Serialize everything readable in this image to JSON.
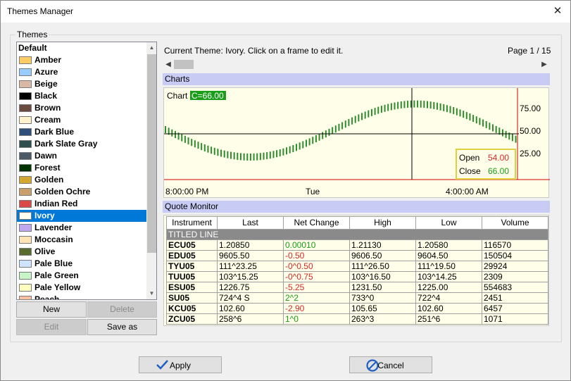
{
  "window": {
    "title": "Themes Manager",
    "close_glyph": "✕"
  },
  "themes_group": {
    "label": "Themes"
  },
  "themes": [
    {
      "name": "Default",
      "color": ""
    },
    {
      "name": "Amber",
      "color": "#ffcc66"
    },
    {
      "name": "Azure",
      "color": "#99ccff"
    },
    {
      "name": "Beige",
      "color": "#d9b8a6"
    },
    {
      "name": "Black",
      "color": "#000000"
    },
    {
      "name": "Brown",
      "color": "#6b4a3f"
    },
    {
      "name": "Cream",
      "color": "#fff2cc"
    },
    {
      "name": "Dark Blue",
      "color": "#2f4f7a"
    },
    {
      "name": "Dark Slate Gray",
      "color": "#2f4f4f"
    },
    {
      "name": "Dawn",
      "color": "#4a5a66"
    },
    {
      "name": "Forest",
      "color": "#003300"
    },
    {
      "name": "Golden",
      "color": "#d4a830"
    },
    {
      "name": "Golden Ochre",
      "color": "#c8a070"
    },
    {
      "name": "Indian Red",
      "color": "#d94a4a"
    },
    {
      "name": "Ivory",
      "color": "#fffff0",
      "selected": true
    },
    {
      "name": "Lavender",
      "color": "#c0a8f0"
    },
    {
      "name": "Moccasin",
      "color": "#ffe4b5"
    },
    {
      "name": "Olive",
      "color": "#5a6b2f"
    },
    {
      "name": "Pale Blue",
      "color": "#cfe4ff"
    },
    {
      "name": "Pale Green",
      "color": "#c8f5c8"
    },
    {
      "name": "Pale Yellow",
      "color": "#ffffc0"
    },
    {
      "name": "Peach",
      "color": "#ffc0a0"
    }
  ],
  "list_buttons": {
    "new": "New",
    "delete": "Delete",
    "edit": "Edit",
    "save_as": "Save as"
  },
  "preview": {
    "current_theme_text": "Current Theme: Ivory. Click on a frame to edit it.",
    "page": "Page 1 / 15"
  },
  "charts_section": {
    "label": "Charts"
  },
  "chart_data": {
    "type": "line",
    "title": "Chart",
    "last_value_badge": "C=66.00",
    "y_tick_labels": [
      "75.00",
      "50.00",
      "25.00"
    ],
    "ylim": [
      0,
      100
    ],
    "x_tick_labels": [
      "8:00:00 PM",
      "Tue",
      "4:00:00 AM"
    ],
    "series": [
      {
        "color": "#2e8b2e",
        "shape": "sine",
        "y_min": 20,
        "y_max": 78
      }
    ],
    "crosshair": {
      "y": 46
    },
    "data_box": {
      "open_label": "Open",
      "open_value": "54.00",
      "close_label": "Close",
      "close_value": "66.00"
    },
    "grid": false
  },
  "quote_section": {
    "label": "Quote Monitor"
  },
  "quote_columns": [
    "Instrument",
    "Last",
    "Net Change",
    "High",
    "Low",
    "Volume"
  ],
  "titled_line": "TITLED LINE",
  "quotes": [
    {
      "instrument": "ECU05",
      "last": "1.20850",
      "net": "0.00010",
      "dir": "pos",
      "high": "1.21130",
      "low": "1.20580",
      "volume": "116570"
    },
    {
      "instrument": "EDU05",
      "last": "9605.50",
      "net": "-0.50",
      "dir": "neg",
      "high": "9606.50",
      "low": "9604.50",
      "volume": "150504"
    },
    {
      "instrument": "TYU05",
      "last": "111^23.25",
      "net": "-0^0.50",
      "dir": "neg",
      "high": "111^26.50",
      "low": "111^19.50",
      "volume": "29924"
    },
    {
      "instrument": "TUU05",
      "last": "103^15.25",
      "net": "-0^0.75",
      "dir": "neg",
      "high": "103^16.50",
      "low": "103^14.25",
      "volume": "2309"
    },
    {
      "instrument": "ESU05",
      "last": "1226.75",
      "net": "-5.25",
      "dir": "neg",
      "high": "1231.50",
      "low": "1225.00",
      "volume": "554683"
    },
    {
      "instrument": "SU05",
      "last": "724^4 S",
      "net": "2^2",
      "dir": "pos",
      "high": "733^0",
      "low": "722^4",
      "volume": "2451"
    },
    {
      "instrument": "KCU05",
      "last": "102.60",
      "net": "-2.90",
      "dir": "neg",
      "high": "105.65",
      "low": "102.60",
      "volume": "6457"
    },
    {
      "instrument": "ZCU05",
      "last": "258^6",
      "net": "1^0",
      "dir": "pos",
      "high": "263^3",
      "low": "251^6",
      "volume": "1071"
    }
  ],
  "footer": {
    "apply": "Apply",
    "cancel": "Cancel"
  },
  "colors": {
    "accent": "#0078d7",
    "section_bar": "#c8ccf4",
    "panel_bg": "#fffee8",
    "series": "#2e8b2e",
    "pos": "#1a9e1a",
    "neg": "#d42a2a"
  }
}
